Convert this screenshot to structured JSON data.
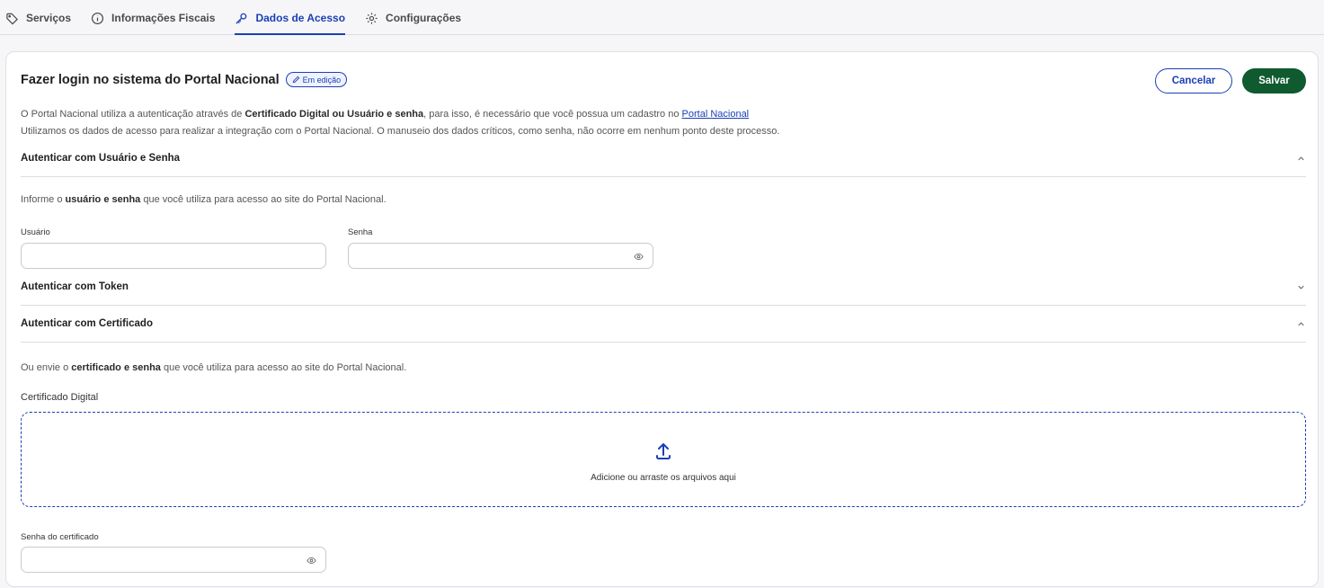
{
  "tabs": [
    {
      "label": "Serviços",
      "icon": "tag-icon"
    },
    {
      "label": "Informações Fiscais",
      "icon": "info-icon"
    },
    {
      "label": "Dados de Acesso",
      "icon": "key-icon",
      "active": true
    },
    {
      "label": "Configurações",
      "icon": "gear-icon"
    }
  ],
  "header": {
    "title": "Fazer login no sistema do Portal Nacional",
    "badge": "Em edição",
    "cancel_label": "Cancelar",
    "save_label": "Salvar"
  },
  "intro": {
    "line1_before": "O Portal Nacional utiliza a autenticação através de ",
    "line1_bold": "Certificado Digital ou Usuário e senha",
    "line1_after": ", para isso, é necessário que você possua um cadastro no ",
    "line1_link": "Portal Nacional",
    "line2": "Utilizamos os dados de acesso para realizar a integração com o Portal Nacional. O manuseio dos dados críticos, como senha, não ocorre em nenhum ponto deste processo."
  },
  "sections": {
    "user": {
      "title": "Autenticar com Usuário e Senha",
      "help_before": "Informe o ",
      "help_bold": "usuário e senha",
      "help_after": " que você utiliza para acesso ao site do Portal Nacional.",
      "user_label": "Usuário",
      "user_value": "",
      "password_label": "Senha",
      "password_value": ""
    },
    "token": {
      "title": "Autenticar com Token"
    },
    "cert": {
      "title": "Autenticar com Certificado",
      "help_before": "Ou envie o ",
      "help_bold": "certificado e senha",
      "help_after": " que você utiliza para acesso ao site do Portal Nacional.",
      "cert_label": "Certificado Digital",
      "dropzone_text": "Adicione ou arraste os arquivos aqui",
      "cert_password_label": "Senha do certificado",
      "cert_password_value": ""
    }
  },
  "colors": {
    "accent": "#1b3fb5",
    "save": "#0f5a2f"
  }
}
